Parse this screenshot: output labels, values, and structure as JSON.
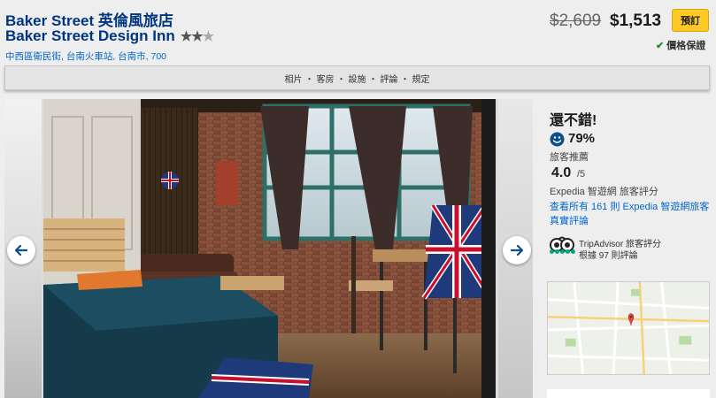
{
  "hotel": {
    "name_zh": "Baker Street 英倫風旅店",
    "name_en": "Baker Street Design Inn",
    "star_rating": 2.5,
    "address": "中西區衛民街, 台南火車站, 台南市, 700"
  },
  "price": {
    "original": "$2,609",
    "current": "$1,513",
    "book_label": "預訂",
    "guarantee": "價格保證"
  },
  "tabs": [
    "相片",
    "客房",
    "設施",
    "評論",
    "規定"
  ],
  "tab_separator": "・",
  "review": {
    "verdict": "還不錯!",
    "recommend_pct": "79%",
    "recommend_label": "旅客推薦",
    "score": "4.0",
    "score_max": "/5",
    "score_label": "Expedia 智遊網 旅客評分",
    "all_reviews_link": "查看所有 161 則 Expedia 智遊網旅客真實評論",
    "tripadvisor_title": "TripAdvisor 旅客評分",
    "tripadvisor_count": "根據 97 則評論"
  },
  "colors": {
    "brand_blue": "#003580",
    "link_blue": "#0066cc",
    "book_yellow": "#fcc925",
    "check_green": "#1a8a2a",
    "tripadvisor_green": "#00a680"
  },
  "icons": {
    "prev": "arrow-left-icon",
    "next": "arrow-right-icon",
    "check": "check-icon",
    "smiley": "smiley-icon",
    "tripadvisor": "tripadvisor-owl-icon"
  }
}
